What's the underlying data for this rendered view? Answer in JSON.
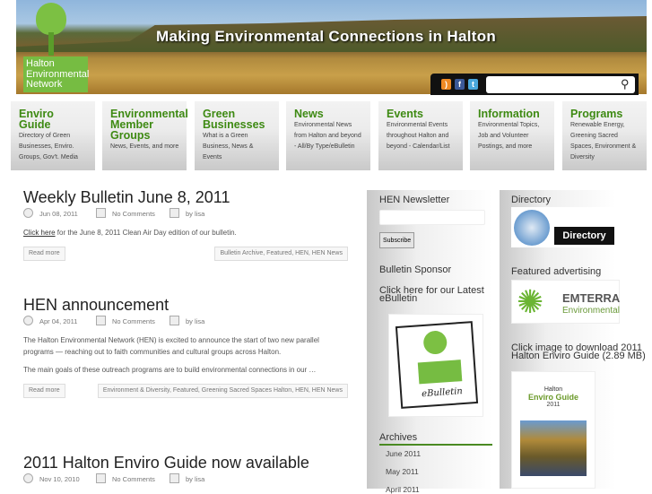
{
  "header": {
    "tagline": "Making Environmental Connections in Halton",
    "logo_lines": [
      "Halton",
      "Environmental",
      "Network"
    ],
    "search_placeholder": ""
  },
  "nav": [
    {
      "title": "Enviro Guide",
      "desc": "Directory of Green Businesses, Enviro. Groups, Gov't. Media"
    },
    {
      "title": "Environmental Member Groups",
      "desc": "News, Events, and more"
    },
    {
      "title": "Green Businesses",
      "desc": "What is a Green Business, News & Events"
    },
    {
      "title": "News",
      "desc": "Environmental News from Halton and beyond - All/By Type/eBulletin"
    },
    {
      "title": "Events",
      "desc": "Environmental Events throughout Halton and beyond - Calendar/List"
    },
    {
      "title": "Information",
      "desc": "Environmental Topics, Job and Volunteer Postings, and more"
    },
    {
      "title": "Programs",
      "desc": "Renewable Energy, Greening Sacred Spaces, Environment & Diversity"
    }
  ],
  "posts": [
    {
      "title": "Weekly Bulletin June 8, 2011",
      "date": "Jun 08, 2011",
      "comments": "No Comments",
      "author": "by lisa",
      "link": "Click here",
      "body": " for the June 8, 2011 Clean Air Day edition of our bulletin.",
      "read_more": "Read more",
      "tags": "Bulletin Archive, Featured, HEN, HEN News"
    },
    {
      "title": "HEN announcement",
      "date": "Apr 04, 2011",
      "comments": "No Comments",
      "author": "by lisa",
      "body1": "The Halton Environmental Network (HEN) is excited to announce the start of two new parallel programs — reaching out to faith communities and cultural groups across Halton.",
      "body2": "The main goals of these outreach programs are to build environmental connections in our …",
      "read_more": "Read more",
      "tags": "Environment & Diversity, Featured, Greening Sacred Spaces Halton, HEN, HEN News"
    },
    {
      "title": "2011 Halton Enviro Guide now available",
      "date": "Nov 10, 2010",
      "comments": "No Comments",
      "author": "by lisa"
    }
  ],
  "sidebar1": {
    "newsletter_title": "HEN Newsletter",
    "subscribe": "Subscribe",
    "sponsor_title": "Bulletin Sponsor",
    "latest": "Click here for our Latest eBulletin",
    "ebulletin_label": "eBulletin",
    "archives_title": "Archives",
    "archives": [
      "June 2011",
      "May 2011",
      "April 2011"
    ]
  },
  "sidebar2": {
    "directory_title": "Directory",
    "directory_label": "Directory",
    "featured_title": "Featured advertising",
    "emterra": "EMTERRA",
    "emterra_sub": "Environmental",
    "guide_text": "Click image to download 2011 Halton Enviro Guide (2.89 MB)",
    "guide_cover": [
      "Halton",
      "Enviro Guide",
      "2011"
    ]
  }
}
